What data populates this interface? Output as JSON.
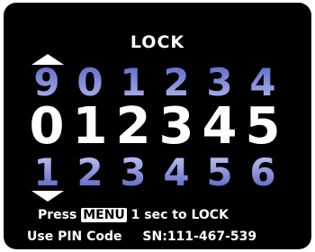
{
  "title": "LOCK",
  "rows": {
    "previous": [
      "9",
      "0",
      "1",
      "2",
      "3",
      "4"
    ],
    "current": [
      "0",
      "1",
      "2",
      "3",
      "4",
      "5"
    ],
    "next": [
      "1",
      "2",
      "3",
      "4",
      "5",
      "6"
    ]
  },
  "icons": {
    "up": "up-arrow-icon",
    "down": "down-arrow-icon"
  },
  "footer": {
    "press_label": "Press",
    "menu_key_label": "MENU",
    "lock_hint": "1 sec to LOCK",
    "pin_hint": "Use PIN Code",
    "serial_number": "SN:111-467-539"
  },
  "colors": {
    "background": "#000000",
    "text": "#ffffff",
    "inactive_digit": "#7b86d8"
  }
}
